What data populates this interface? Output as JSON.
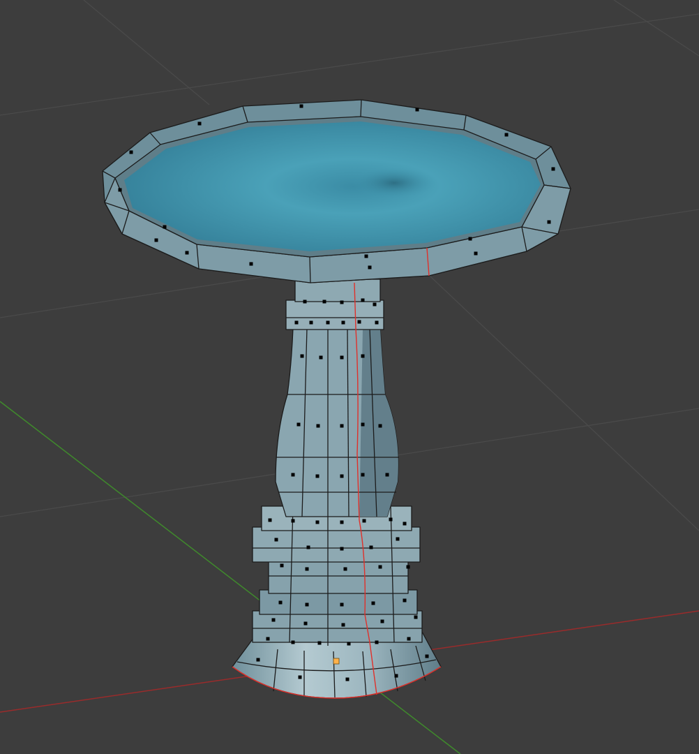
{
  "viewport": {
    "background": "#3d3d3d",
    "grid_color": "#4a4a4a",
    "axis_x_color": "#9a2b2b",
    "axis_y_color": "#3f8a2c"
  },
  "object": {
    "name": "birdbath",
    "shading": {
      "water_color": "#3f95ae",
      "rim_color": "#7b9aa6",
      "pedestal_color": "#8ea9b2",
      "edge_color": "#1b1b1b",
      "seam_color": "#e0302a",
      "vertex_color": "#000000",
      "active_vertex_color": "#ffb24a"
    },
    "rim_segments": 12,
    "pedestal_segments": 8
  }
}
